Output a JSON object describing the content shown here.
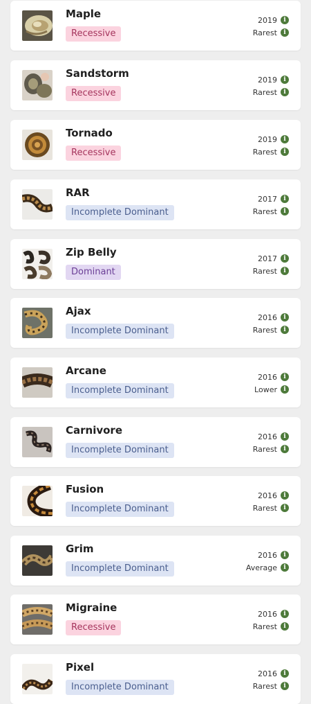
{
  "colors": {
    "recessive_bg": "#fbd3df",
    "recessive_text": "#a5355d",
    "incomplete_dominant_bg": "#dde4f4",
    "incomplete_dominant_text": "#4a5e8e",
    "dominant_bg": "#e2d7f2",
    "dominant_text": "#6b3f96",
    "info_icon": "#4d7a3a"
  },
  "info_icon_glyph": "i",
  "morphs": [
    {
      "name": "Maple",
      "type": "Recessive",
      "type_class": "recessive",
      "year": "2019",
      "rarity": "Rarest",
      "photo": "maple-snake-photo"
    },
    {
      "name": "Sandstorm",
      "type": "Recessive",
      "type_class": "recessive",
      "year": "2019",
      "rarity": "Rarest",
      "photo": "sandstorm-snake-photo"
    },
    {
      "name": "Tornado",
      "type": "Recessive",
      "type_class": "recessive",
      "year": "2019",
      "rarity": "Rarest",
      "photo": "tornado-snake-photo"
    },
    {
      "name": "RAR",
      "type": "Incomplete Dominant",
      "type_class": "incdom",
      "year": "2017",
      "rarity": "Rarest",
      "photo": "rar-snake-photo"
    },
    {
      "name": "Zip Belly",
      "type": "Dominant",
      "type_class": "dominant",
      "year": "2017",
      "rarity": "Rarest",
      "photo": "zip-belly-snake-photo"
    },
    {
      "name": "Ajax",
      "type": "Incomplete Dominant",
      "type_class": "incdom",
      "year": "2016",
      "rarity": "Rarest",
      "photo": "ajax-snake-photo"
    },
    {
      "name": "Arcane",
      "type": "Incomplete Dominant",
      "type_class": "incdom",
      "year": "2016",
      "rarity": "Lower",
      "photo": "arcane-snake-photo"
    },
    {
      "name": "Carnivore",
      "type": "Incomplete Dominant",
      "type_class": "incdom",
      "year": "2016",
      "rarity": "Rarest",
      "photo": "carnivore-snake-photo"
    },
    {
      "name": "Fusion",
      "type": "Incomplete Dominant",
      "type_class": "incdom",
      "year": "2016",
      "rarity": "Rarest",
      "photo": "fusion-snake-photo"
    },
    {
      "name": "Grim",
      "type": "Incomplete Dominant",
      "type_class": "incdom",
      "year": "2016",
      "rarity": "Average",
      "photo": "grim-snake-photo"
    },
    {
      "name": "Migraine",
      "type": "Recessive",
      "type_class": "recessive",
      "year": "2016",
      "rarity": "Rarest",
      "photo": "migraine-snake-photo"
    },
    {
      "name": "Pixel",
      "type": "Incomplete Dominant",
      "type_class": "incdom",
      "year": "2016",
      "rarity": "Rarest",
      "photo": "pixel-snake-photo"
    }
  ]
}
